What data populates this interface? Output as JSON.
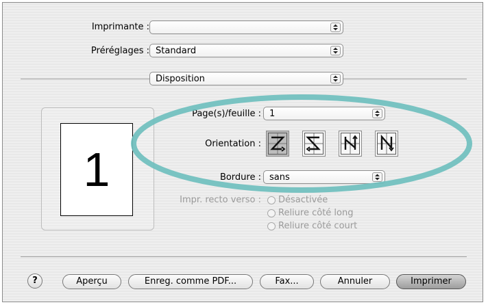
{
  "printer": {
    "label": "Imprimante :",
    "value": ""
  },
  "presets": {
    "label": "Préréglages :",
    "value": "Standard"
  },
  "panel": {
    "value": "Disposition"
  },
  "preview": {
    "page_number": "1"
  },
  "layout": {
    "pages_label": "Page(s)/feuille :",
    "pages_value": "1",
    "orientation_label": "Orientation :",
    "orientation_icons": [
      "z-order-icon",
      "reverse-z-order-icon",
      "reverse-n-order-icon",
      "n-order-icon"
    ],
    "orientation_selected": 0,
    "border_label": "Bordure :",
    "border_value": "sans",
    "duplex_label": "Impr. recto verso :",
    "duplex_options": [
      "Désactivée",
      "Reliure côté long",
      "Reliure côté court"
    ]
  },
  "buttons": {
    "help": "?",
    "preview": "Aperçu",
    "save_pdf": "Enreg. comme PDF...",
    "fax": "Fax...",
    "cancel": "Annuler",
    "print": "Imprimer"
  },
  "colors": {
    "highlight_ellipse": "#6fbfbe"
  }
}
